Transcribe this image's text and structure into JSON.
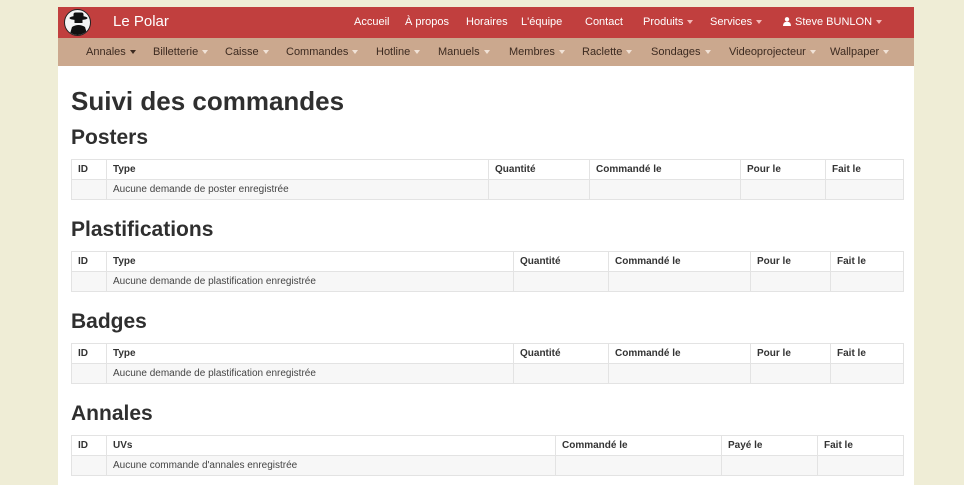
{
  "header": {
    "brand": "Le Polar",
    "nav": [
      "Accueil",
      "À propos",
      "Horaires",
      "L'équipe",
      "Contact"
    ],
    "dropdowns": [
      "Produits",
      "Services"
    ],
    "user": "Steve BUNLON",
    "colors": {
      "navbar": "#c13f3e",
      "subbar": "#cba88e"
    }
  },
  "subnav": {
    "items": [
      "Annales",
      "Billetterie",
      "Caisse",
      "Commandes",
      "Hotline",
      "Manuels",
      "Membres",
      "Raclette",
      "Sondages",
      "Videoprojecteur",
      "Wallpaper"
    ],
    "active": "Annales"
  },
  "page_title": "Suivi des commandes",
  "sections": [
    {
      "title": "Posters",
      "columns": [
        "ID",
        "Type",
        "Quantité",
        "Commandé le",
        "Pour le",
        "Fait le"
      ],
      "empty": "Aucune demande de poster enregistrée"
    },
    {
      "title": "Plastifications",
      "columns": [
        "ID",
        "Type",
        "Quantité",
        "Commandé le",
        "Pour le",
        "Fait le"
      ],
      "empty": "Aucune demande de plastification enregistrée"
    },
    {
      "title": "Badges",
      "columns": [
        "ID",
        "Type",
        "Quantité",
        "Commandé le",
        "Pour le",
        "Fait le"
      ],
      "empty": "Aucune demande de plastification enregistrée"
    },
    {
      "title": "Annales",
      "columns": [
        "ID",
        "UVs",
        "Commandé le",
        "Payé le",
        "Fait le"
      ],
      "empty": "Aucune commande d'annales enregistrée"
    }
  ]
}
